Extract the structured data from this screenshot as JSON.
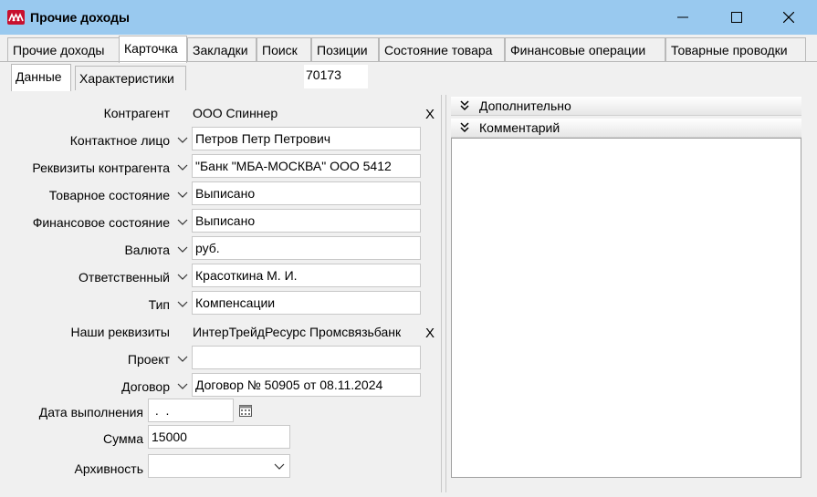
{
  "window": {
    "title": "Прочие доходы"
  },
  "tabs": [
    {
      "label": "Прочие доходы"
    },
    {
      "label": "Карточка"
    },
    {
      "label": "Закладки"
    },
    {
      "label": "Поиск"
    },
    {
      "label": "Позиции"
    },
    {
      "label": "Состояние товара"
    },
    {
      "label": "Финансовые операции"
    },
    {
      "label": "Товарные проводки"
    }
  ],
  "active_tab": "Карточка",
  "subtabs": [
    {
      "label": "Данные"
    },
    {
      "label": "Характеристики"
    }
  ],
  "doc_number": "70173",
  "form": {
    "counterparty": {
      "label": "Контрагент",
      "value": "ООО Спиннер",
      "clear": "X"
    },
    "contact": {
      "label": "Контактное лицо",
      "value": "Петров Петр Петрович"
    },
    "requisites": {
      "label": "Реквизиты контрагента",
      "value": "\"Банк \"МБА-МОСКВА\" ООО 5412"
    },
    "goods_state": {
      "label": "Товарное состояние",
      "value": "Выписано"
    },
    "finance_state": {
      "label": "Финансовое состояние",
      "value": "Выписано"
    },
    "currency": {
      "label": "Валюта",
      "value": "руб."
    },
    "responsible": {
      "label": "Ответственный",
      "value": "Красоткина М. И."
    },
    "type": {
      "label": "Тип",
      "value": "Компенсации"
    },
    "our_requisites": {
      "label": "Наши реквизиты",
      "value": "ИнтерТрейдРесурс Промсвязьбанк",
      "clear": "X"
    },
    "project": {
      "label": "Проект",
      "value": ""
    },
    "contract": {
      "label": "Договор",
      "value": "Договор № 50905 от 08.11.2024"
    },
    "completion_date": {
      "label": "Дата выполнения",
      "value": " .  ."
    },
    "amount": {
      "label": "Сумма",
      "value": "15000"
    },
    "archive": {
      "label": "Архивность",
      "value": ""
    }
  },
  "right_panel": {
    "extra_label": "Дополнительно",
    "comment_label": "Комментарий",
    "comment_text": ""
  }
}
